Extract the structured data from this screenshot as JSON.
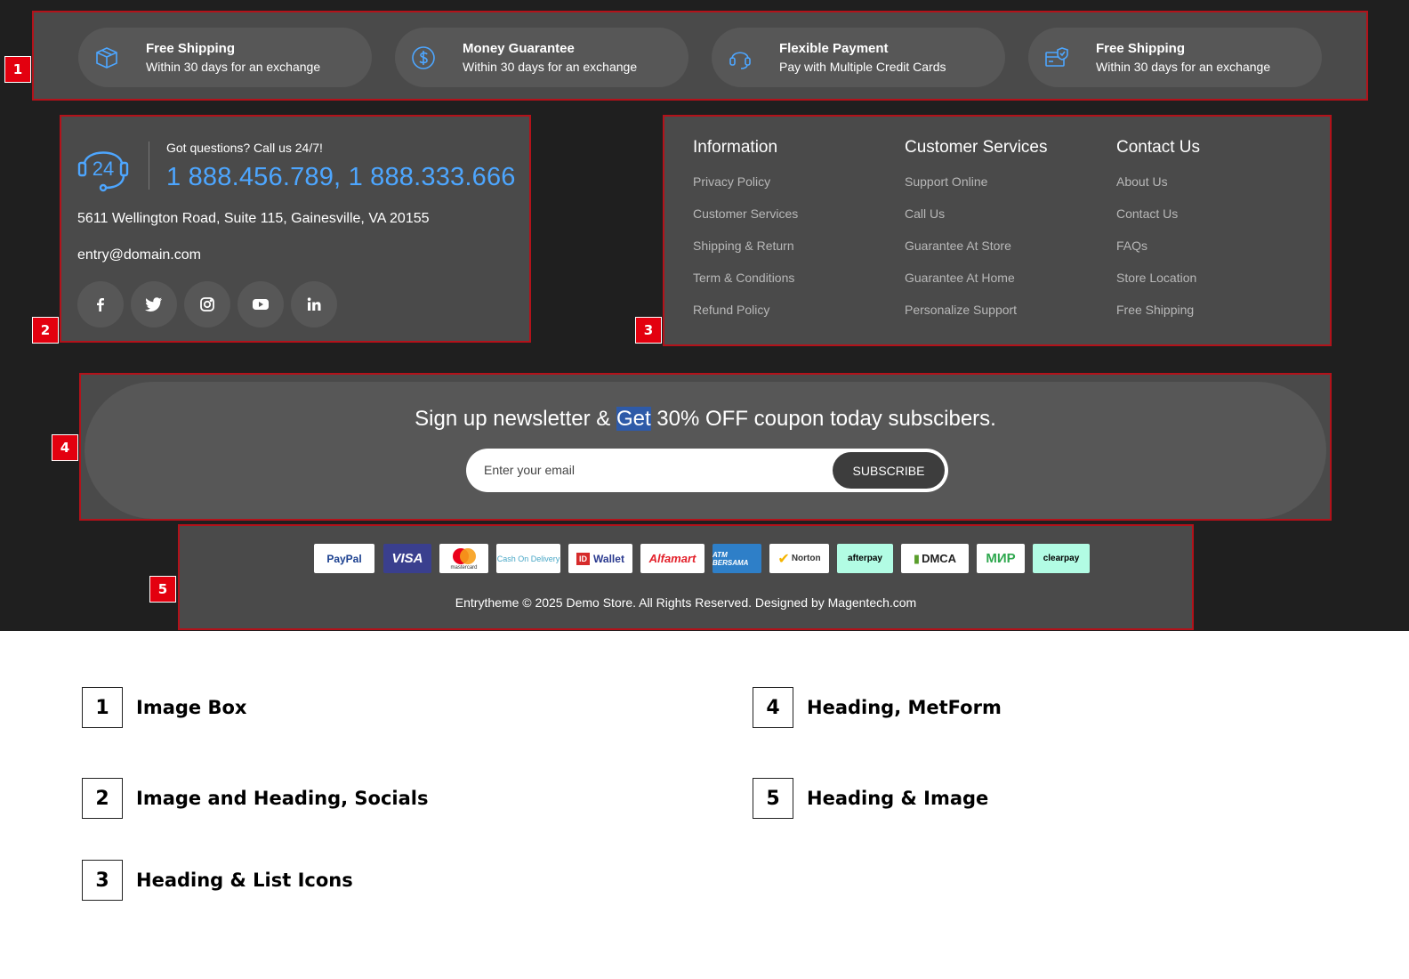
{
  "features": [
    {
      "title": "Free Shipping",
      "subtitle": "Within 30 days for an exchange",
      "icon": "box-icon"
    },
    {
      "title": "Money Guarantee",
      "subtitle": "Within 30 days for an exchange",
      "icon": "dollar-circle-icon"
    },
    {
      "title": "Flexible Payment",
      "subtitle": "Pay with Multiple Credit Cards",
      "icon": "headset-icon"
    },
    {
      "title": "Free Shipping",
      "subtitle": "Within 30 days for an exchange",
      "icon": "card-shield-icon"
    }
  ],
  "contact": {
    "question": "Got questions? Call us 24/7!",
    "phones": "1 888.456.789, 1 888.333.666",
    "address": "5611 Wellington Road, Suite 115, Gainesville, VA 20155",
    "email": "entry@domain.com",
    "icon_text": "24",
    "socials": [
      "facebook-icon",
      "twitter-icon",
      "instagram-icon",
      "youtube-icon",
      "linkedin-icon"
    ]
  },
  "links": {
    "columns": [
      {
        "heading": "Information",
        "items": [
          "Privacy Policy",
          "Customer Services",
          "Shipping & Return",
          "Term & Conditions",
          "Refund Policy"
        ]
      },
      {
        "heading": "Customer Services",
        "items": [
          "Support Online",
          "Call Us",
          "Guarantee At Store",
          "Guarantee At Home",
          "Personalize Support"
        ]
      },
      {
        "heading": "Contact Us",
        "items": [
          "About Us",
          "Contact Us",
          "FAQs",
          "Store Location",
          "Free Shipping"
        ]
      }
    ]
  },
  "newsletter": {
    "text_before": "Sign up newsletter & ",
    "text_highlight": "Get",
    "text_after": " 30% OFF coupon today subscibers.",
    "placeholder": "Enter your email",
    "button": "SUBSCRIBE"
  },
  "payments": {
    "logos": [
      "PayPal",
      "VISA",
      "mastercard",
      "Cash On Delivery",
      "Wallet",
      "Alfamart",
      "ATM BERSAMA",
      "Norton",
      "afterpay",
      "DMCA",
      "МИР",
      "clearpay"
    ],
    "copyright": "Entrytheme © 2025 Demo Store. All Rights Reserved. Designed by Magentech.com"
  },
  "tags": [
    "1",
    "2",
    "3",
    "4",
    "5"
  ],
  "legend": [
    {
      "num": "1",
      "label": "Image Box"
    },
    {
      "num": "2",
      "label": "Image and Heading, Socials"
    },
    {
      "num": "3",
      "label": "Heading & List Icons"
    },
    {
      "num": "4",
      "label": "Heading, MetForm"
    },
    {
      "num": "5",
      "label": "Heading & Image"
    }
  ],
  "colors": {
    "accent": "#4da6ff",
    "tag": "#e3000f",
    "panel": "#4a4a4a",
    "background": "#1f1f1f"
  }
}
